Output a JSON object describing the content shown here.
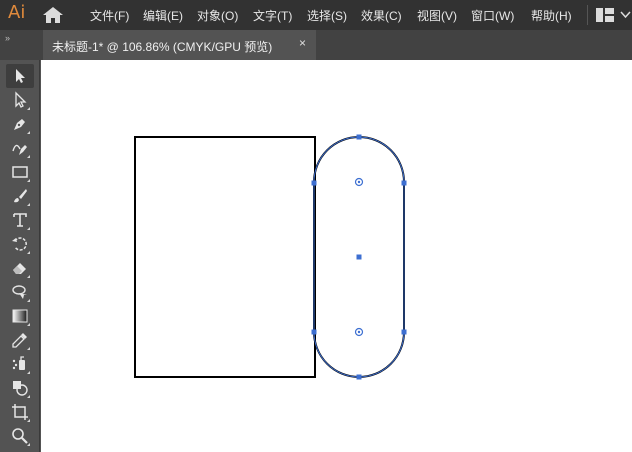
{
  "app": {
    "logo_text": "Ai",
    "brand_color": "#e08a3c",
    "accent_color": "#3d6fd1"
  },
  "menu": {
    "items": [
      "文件(F)",
      "编辑(E)",
      "对象(O)",
      "文字(T)",
      "选择(S)",
      "效果(C)",
      "视图(V)",
      "窗口(W)",
      "帮助(H)"
    ],
    "home_icon": "home-icon",
    "workspace_icon": "workspace-switcher-icon"
  },
  "tabs": {
    "panel_toggle": "»",
    "document": {
      "title": "未标题-1* @ 106.86% (CMYK/GPU 预览)",
      "close": "×"
    }
  },
  "toolbar": {
    "tools": [
      {
        "name": "selection-tool",
        "icon": "arrow-icon",
        "active": true
      },
      {
        "name": "direct-selection-tool",
        "icon": "white-arrow-icon"
      },
      {
        "name": "pen-tool",
        "icon": "pen-icon"
      },
      {
        "name": "curvature-tool",
        "icon": "curvature-pen-icon"
      },
      {
        "name": "rectangle-tool",
        "icon": "rectangle-icon"
      },
      {
        "name": "paintbrush-tool",
        "icon": "paintbrush-icon"
      },
      {
        "name": "type-tool",
        "icon": "type-icon"
      },
      {
        "name": "rotate-tool",
        "icon": "rotate-icon"
      },
      {
        "name": "eraser-tool",
        "icon": "eraser-icon"
      },
      {
        "name": "lasso-tool",
        "icon": "lasso-icon"
      },
      {
        "name": "gradient-tool",
        "icon": "gradient-icon"
      },
      {
        "name": "eyedropper-tool",
        "icon": "eyedropper-icon"
      },
      {
        "name": "symbol-sprayer-tool",
        "icon": "symbol-sprayer-icon"
      },
      {
        "name": "shape-builder-tool",
        "icon": "shape-builder-icon"
      },
      {
        "name": "artboard-tool",
        "icon": "artboard-icon"
      },
      {
        "name": "zoom-tool",
        "icon": "zoom-icon"
      }
    ]
  },
  "canvas": {
    "background": "#ffffff",
    "objects": [
      {
        "type": "rectangle",
        "stroke": "#000000"
      },
      {
        "type": "rounded-pill",
        "stroke": "#000000",
        "selected": true,
        "selection_color": "#3d6fd1"
      }
    ]
  }
}
